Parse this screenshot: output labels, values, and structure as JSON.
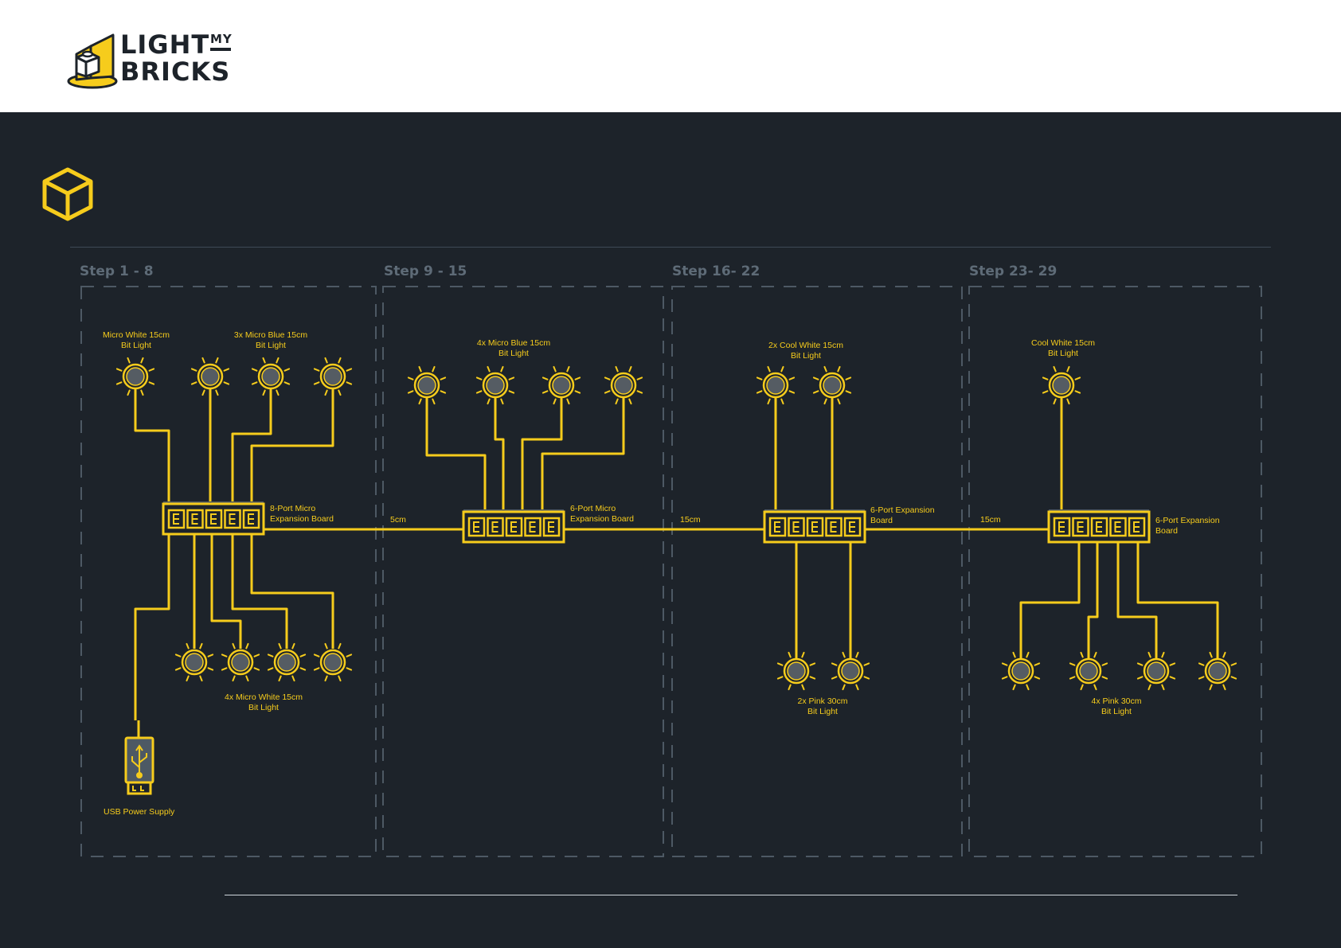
{
  "brand": {
    "line1": "LIGHT",
    "line2": "BRICKS",
    "small": "MY"
  },
  "colors": {
    "accent": "#f6cc1c",
    "background": "#1d232a",
    "header": "#ffffff",
    "dashes": "#4d5964"
  },
  "icons": {
    "header_icon": "cube-icon",
    "power": "usb-icon"
  },
  "steps": [
    {
      "title": "Step 1 - 8"
    },
    {
      "title": "Step 9 - 15"
    },
    {
      "title": "Step 16- 22"
    },
    {
      "title": "Step 23- 29"
    }
  ],
  "labels": {
    "s1_top_left": [
      "Micro White 15cm",
      "Bit Light"
    ],
    "s1_top_right": [
      "3x Micro Blue 15cm",
      "Bit Light"
    ],
    "s1_board": [
      "8-Port Micro",
      "Expansion Board"
    ],
    "s1_bottom": [
      "4x Micro White 15cm",
      "Bit Light"
    ],
    "s1_usb": "USB Power Supply",
    "s2_top": [
      "4x Micro Blue 15cm",
      "Bit Light"
    ],
    "s2_board": [
      "6-Port Micro",
      "Expansion Board"
    ],
    "s2_cable": "5cm",
    "s3_top": [
      "2x Cool White 15cm",
      "Bit Light"
    ],
    "s3_board": [
      "6-Port Expansion",
      "Board"
    ],
    "s3_cable": "15cm",
    "s3_bottom": [
      "2x Pink 30cm",
      "Bit Light"
    ],
    "s4_top": [
      "Cool White 15cm",
      "Bit Light"
    ],
    "s4_board": [
      "6-Port Expansion",
      "Board"
    ],
    "s4_cable": "15cm",
    "s4_bottom": [
      "4x Pink 30cm",
      "Bit Light"
    ]
  }
}
